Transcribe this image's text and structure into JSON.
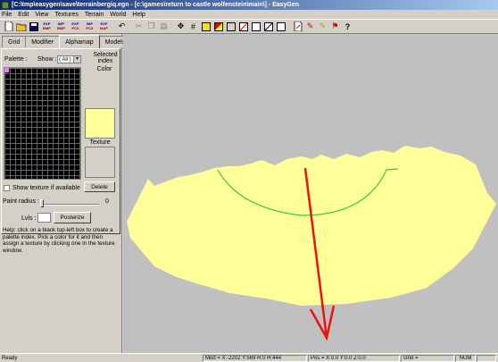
{
  "window": {
    "title": "[C:\\tmp\\easygen\\save\\terrainbergiq.egn - [c:\\games\\return to castle wolfenstein\\main\\] - EasyGen"
  },
  "menu": [
    "File",
    "Edit",
    "View",
    "Textures",
    "Terrain",
    "World",
    "Help"
  ],
  "toolbar": {
    "exp_bmp_top": "EXP",
    "exp_bmp_sub": "BMP",
    "imp_bmp_top": "IMP",
    "imp_bmp_sub": "BMP",
    "exp_pcx_top": "EXP",
    "exp_pcx_sub": "PCX",
    "imp_pcx_top": "IMP",
    "imp_pcx_sub": "PCX",
    "exp_map_top": "EXP",
    "exp_map_sub": "MAP",
    "help_glyph": "?"
  },
  "tabs": [
    {
      "label": "Grid"
    },
    {
      "label": "Modifier"
    },
    {
      "label": "Alphamap"
    },
    {
      "label": "Models"
    }
  ],
  "alphamap": {
    "palette_label": "Palette :",
    "show_label": "Show :",
    "show_value": "( All )",
    "selected_index_label": "Selected index",
    "color_label": "Color",
    "texture_label": "Texture",
    "color_value": "#ffff99",
    "show_texture_label": "Show texture if available",
    "delete_label": "Delete",
    "paint_radius_label": "Paint radius :",
    "paint_radius_value": "0",
    "lvls_label": "Lvls :",
    "posterize_label": "Posterize",
    "help_text": "Help: click on a black top-left box to create a palette index. Pick a color for it and then assign a texture by clicking one in the texture window."
  },
  "status": {
    "ready": "Ready",
    "mod": "Mod = X:-2202 Y:569 R:0 H:444",
    "pos": "Pos = X:0.0 Y:0.0 Z:0.0",
    "grid": "Grid =",
    "num": "NUM"
  },
  "colors": {
    "terrain": "#ffff99",
    "green_curve": "#33cc33",
    "red_arrow": "#ee1111",
    "viewport_bg": "#c0c0c0"
  }
}
